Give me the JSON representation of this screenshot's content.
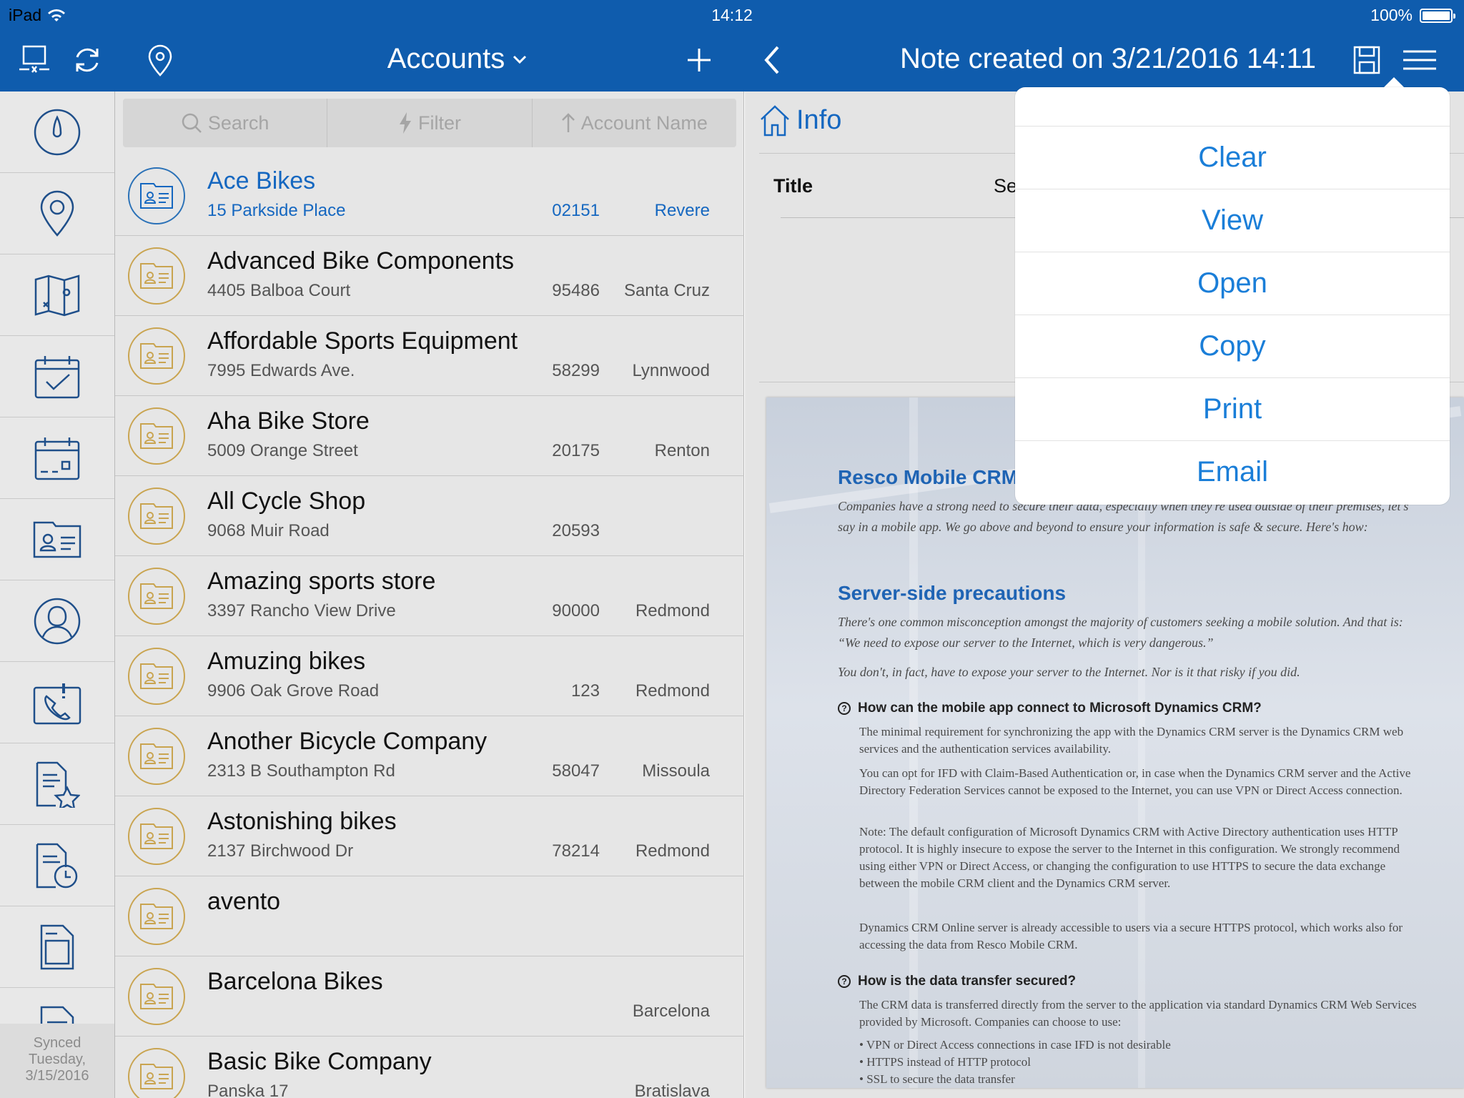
{
  "status": {
    "device": "iPad",
    "time": "14:12",
    "battery": "100%"
  },
  "header": {
    "accounts_title": "Accounts",
    "note_title": "Note created on 3/21/2016 14:11"
  },
  "search": {
    "search_label": "Search",
    "filter_label": "Filter",
    "sort_label": "Account Name"
  },
  "rail": {
    "icons": [
      "dashboard-icon",
      "location-pin-icon",
      "map-icon",
      "calendar-check-icon",
      "calendar-icon",
      "account-card-icon",
      "contact-icon",
      "phone-call-icon",
      "favorite-document-icon",
      "recent-document-icon",
      "document-icon",
      "report-icon"
    ],
    "sync_line1": "Synced",
    "sync_line2": "Tuesday,",
    "sync_line3": "3/15/2016"
  },
  "accounts": [
    {
      "name": "Ace Bikes",
      "address": "15 Parkside Place",
      "zip": "02151",
      "city": "Revere",
      "selected": true
    },
    {
      "name": "Advanced Bike Components",
      "address": "4405 Balboa Court",
      "zip": "95486",
      "city": "Santa Cruz"
    },
    {
      "name": "Affordable Sports Equipment",
      "address": "7995 Edwards Ave.",
      "zip": "58299",
      "city": "Lynnwood"
    },
    {
      "name": "Aha Bike Store",
      "address": "5009 Orange Street",
      "zip": "20175",
      "city": "Renton"
    },
    {
      "name": "All Cycle Shop",
      "address": "9068 Muir Road",
      "zip": "20593",
      "city": ""
    },
    {
      "name": "Amazing sports store",
      "address": "3397 Rancho View Drive",
      "zip": "90000",
      "city": "Redmond"
    },
    {
      "name": "Amuzing bikes",
      "address": "9906 Oak Grove Road",
      "zip": "123",
      "city": "Redmond"
    },
    {
      "name": "Another Bicycle Company",
      "address": "2313 B Southampton Rd",
      "zip": "58047",
      "city": "Missoula"
    },
    {
      "name": "Astonishing bikes",
      "address": "2137 Birchwood Dr",
      "zip": "78214",
      "city": "Redmond"
    },
    {
      "name": "avento",
      "address": "",
      "zip": "",
      "city": ""
    },
    {
      "name": "Barcelona Bikes",
      "address": "",
      "zip": "",
      "city": "Barcelona"
    },
    {
      "name": "Basic Bike Company",
      "address": "Panska 17",
      "zip": "",
      "city": "Bratislava"
    }
  ],
  "detail": {
    "info_label": "Info",
    "title_label": "Title",
    "title_value_partial": "Se"
  },
  "document": {
    "heading1": "Resco Mobile CRM",
    "intro": "Companies have a strong need to secure their data, especially when they're used outside of their premises, let's say in a mobile app. We go above and beyond to ensure your information is safe & secure. Here's how:",
    "heading2": "Server-side precautions",
    "para1": "There's one common misconception amongst the majority of customers seeking a mobile solution. And that is: “We need to expose our server to the Internet, which is very dangerous.”",
    "para2": "You don't, in fact, have to expose your server to the Internet. Nor is it that risky if you did.",
    "q1": "How can the mobile app connect to Microsoft Dynamics CRM?",
    "q1_p1": "The minimal requirement for synchronizing the app with the Dynamics CRM server is the Dynamics CRM web services and the authentication services availability.",
    "q1_p2": "You can opt for IFD with Claim-Based Authentication or, in case when the Dynamics CRM server and the Active Directory Federation Services cannot be exposed to the Internet, you can use VPN or Direct Access connection.",
    "q1_p3": "Note: The default configuration of Microsoft Dynamics CRM with Active Directory authentication uses HTTP protocol. It is highly insecure to expose the server to the Internet in this configuration. We strongly recommend using either VPN or Direct Access, or changing the configuration to use HTTPS to secure the data exchange between the mobile CRM client and the Dynamics CRM server.",
    "q1_p4": "Dynamics CRM Online server is already accessible to users via a secure HTTPS protocol, which works also for accessing the data from Resco Mobile CRM.",
    "q2": "How is the data transfer secured?",
    "q2_p1": "The CRM data is transferred directly from the server to the application via standard Dynamics CRM Web Services provided by Microsoft. Companies can choose to use:",
    "bullets": [
      "VPN or Direct Access connections in case IFD is not desirable",
      "HTTPS instead of HTTP protocol",
      "SSL to secure the data transfer"
    ]
  },
  "menu": {
    "items": [
      "Clear",
      "View",
      "Open",
      "Copy",
      "Print",
      "Email"
    ]
  },
  "colors": {
    "header_bg": "#0f5cad",
    "accent": "#1567c0",
    "menu_text": "#1a7ed8",
    "badge_gold": "#c9a450"
  }
}
